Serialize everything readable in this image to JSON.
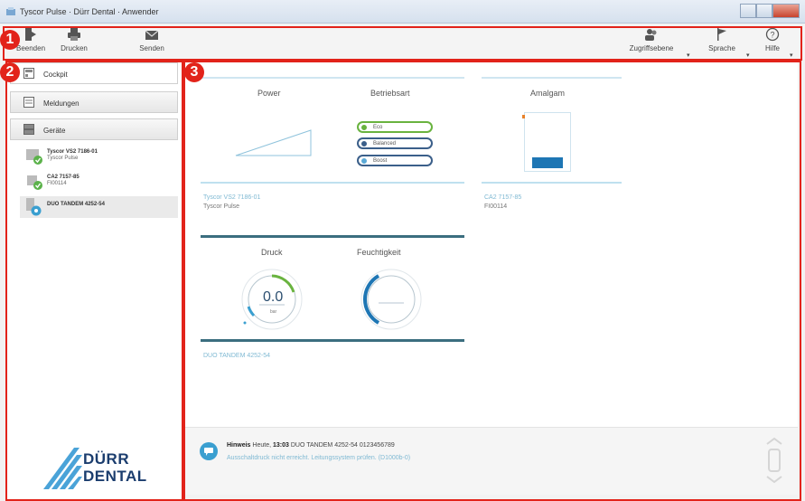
{
  "window": {
    "title": "Tyscor Pulse · Dürr Dental · Anwender"
  },
  "toolbar": {
    "left": [
      {
        "id": "beenden",
        "label": "Beenden",
        "icon": "exit-icon"
      },
      {
        "id": "drucken",
        "label": "Drucken",
        "icon": "printer-icon"
      },
      {
        "id": "senden",
        "label": "Senden",
        "icon": "envelope-icon"
      }
    ],
    "right": [
      {
        "id": "zugriff",
        "label": "Zugriffsebene",
        "icon": "users-icon"
      },
      {
        "id": "sprache",
        "label": "Sprache",
        "icon": "flag-icon"
      },
      {
        "id": "hilfe",
        "label": "Hilfe",
        "icon": "help-icon"
      }
    ]
  },
  "callouts": [
    "1",
    "2",
    "3"
  ],
  "sidebar": {
    "nav": [
      {
        "label": "Cockpit",
        "icon": "cockpit-icon",
        "active": true
      },
      {
        "label": "Meldungen",
        "icon": "messages-icon",
        "active": false
      },
      {
        "label": "Geräte",
        "icon": "devices-icon",
        "active": false
      }
    ],
    "devices": [
      {
        "name": "Tyscor VS2 7186-01",
        "sub": "Tyscor Pulse",
        "status": "ok"
      },
      {
        "name": "CA2 7157-85",
        "sub": "FI00114",
        "status": "ok"
      },
      {
        "name": "DUO TANDEM 4252-54",
        "sub": "",
        "status": "info"
      }
    ],
    "logo": {
      "line1": "DÜRR",
      "line2": "DENTAL"
    }
  },
  "cockpit": {
    "card1": {
      "power_title": "Power",
      "mode_title": "Betriebsart",
      "modes": [
        "Eco",
        "Balanced",
        "Boost"
      ],
      "device_name": "Tyscor VS2 7186-01",
      "device_sub": "Tyscor Pulse"
    },
    "card2": {
      "title": "Amalgam",
      "device_name": "CA2 7157-85",
      "device_sub": "FI00114",
      "fill_level": 0.2
    },
    "card3": {
      "pressure_title": "Druck",
      "pressure_value": "0.0",
      "pressure_unit": "bar",
      "humidity_title": "Feuchtigkeit",
      "device_name": "DUO TANDEM 4252-54"
    }
  },
  "notification": {
    "type": "Hinweis",
    "day": "Heute,",
    "time": "13:03",
    "text": "DUO TANDEM 4252-54 0123456789",
    "detail": "Ausschaltdruck nicht erreicht. Leitungssystem prüfen. (D1000b-0)"
  },
  "colors": {
    "accent": "#3a9fd0",
    "frame": "#e2231a",
    "brand": "#1b3d6e",
    "eco": "#69b33f"
  }
}
